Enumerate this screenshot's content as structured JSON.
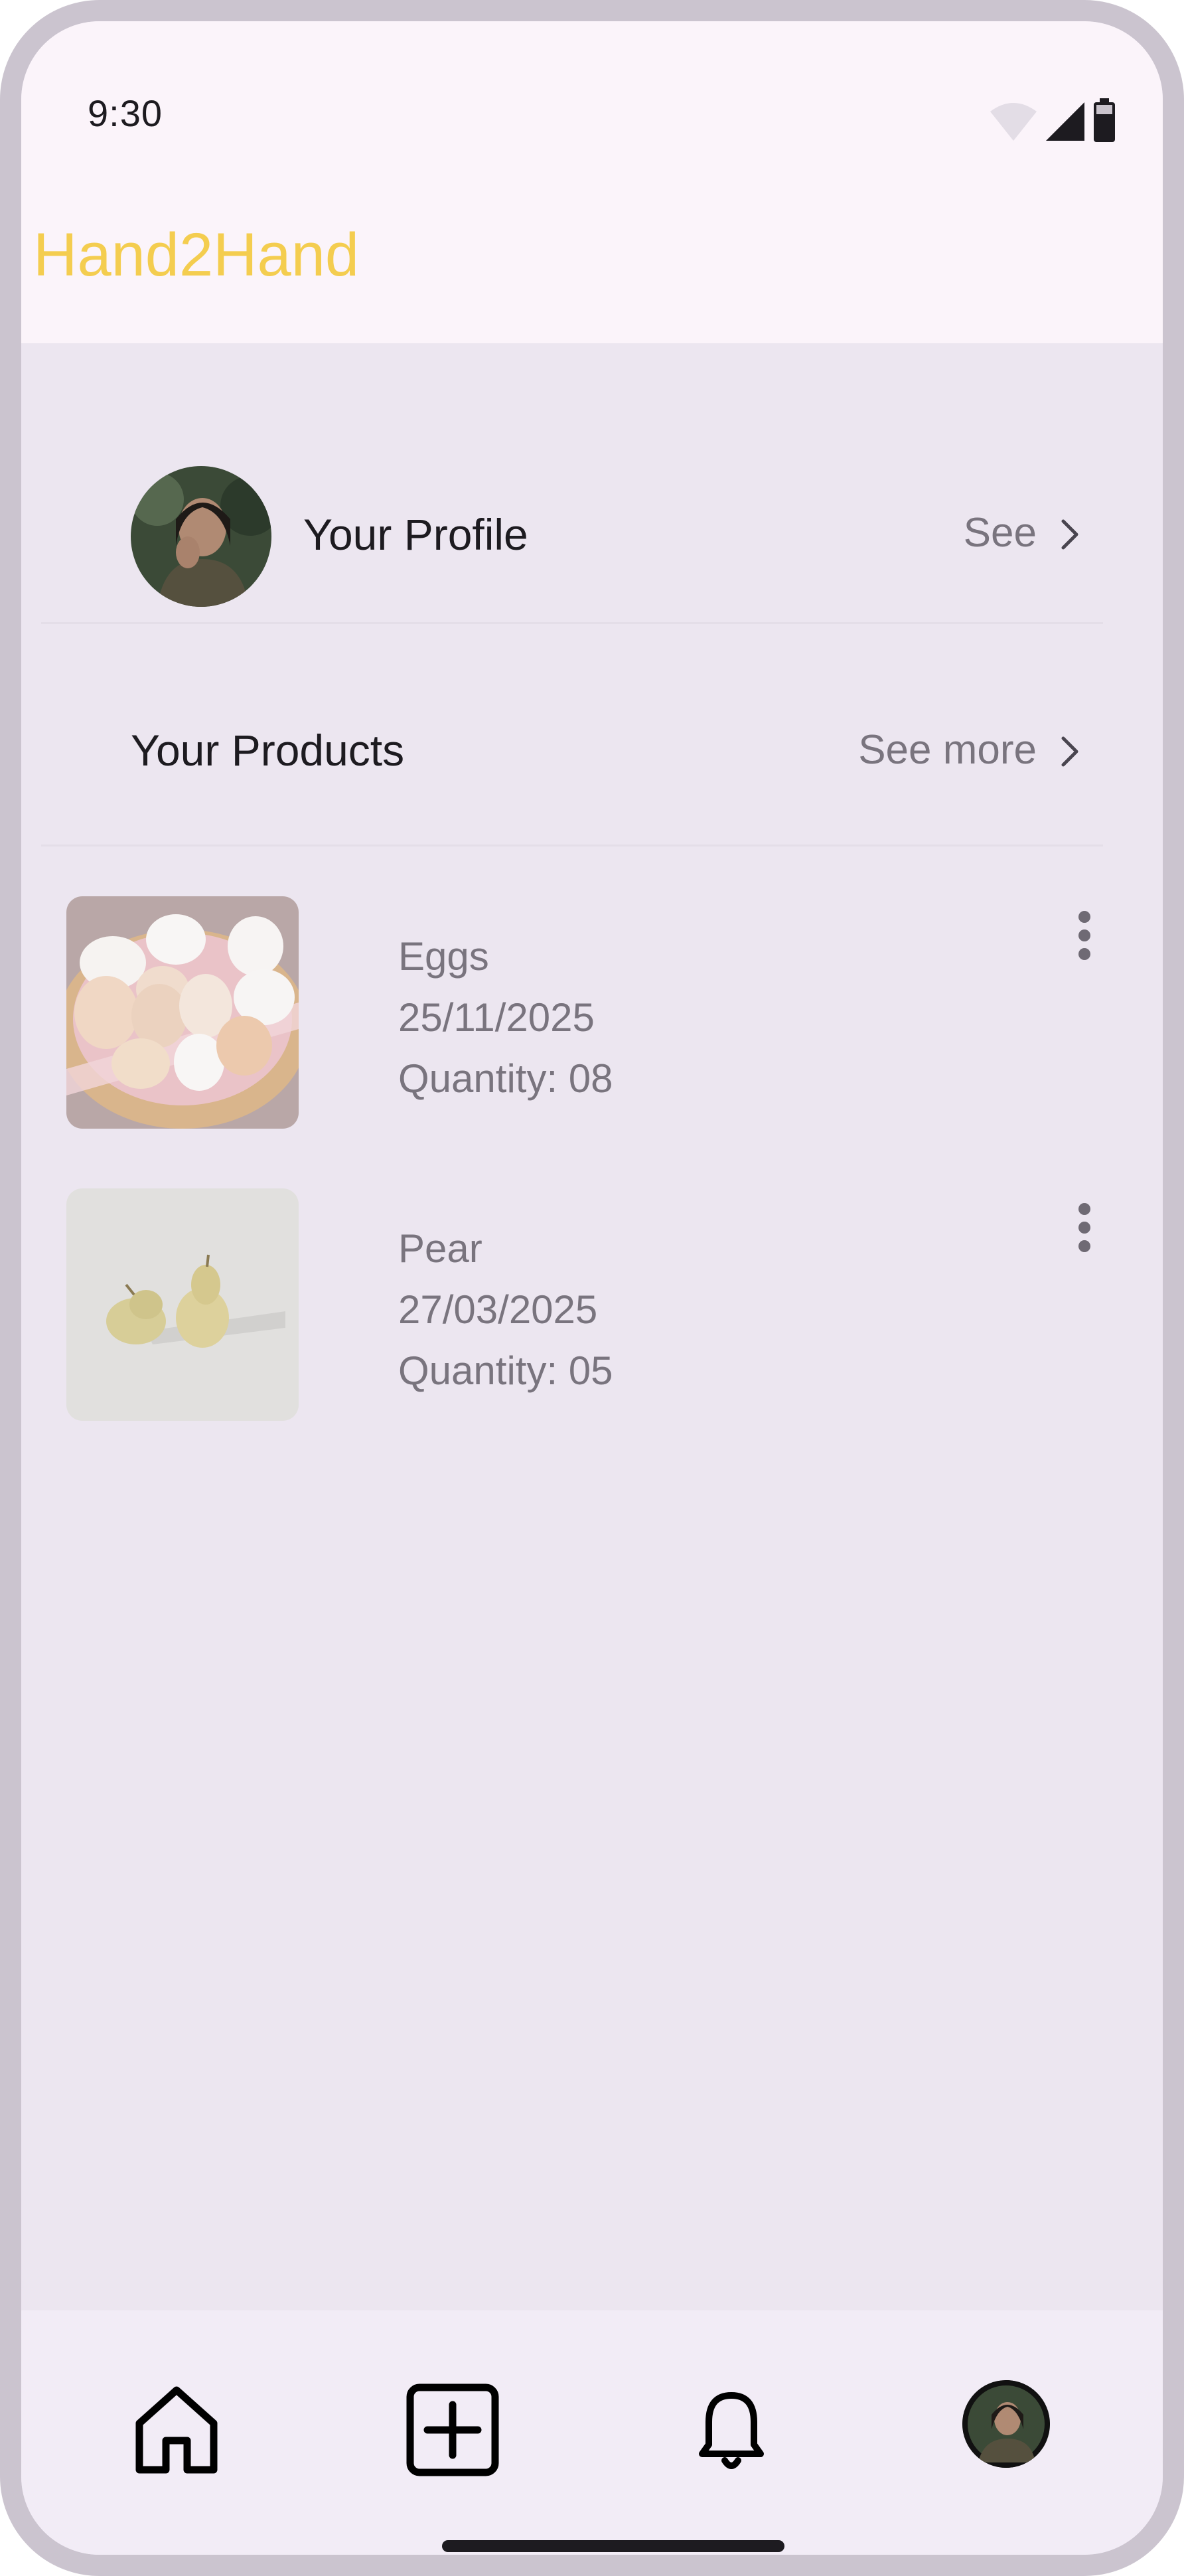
{
  "status_bar": {
    "time": "9:30",
    "icons": [
      "wifi-icon",
      "cellular-signal-icon",
      "battery-icon"
    ]
  },
  "app": {
    "title": "Hand2Hand",
    "title_color": "#F4CD4F"
  },
  "profile_row": {
    "label": "Your Profile",
    "action": "See"
  },
  "products_row": {
    "label": "Your Products",
    "action": "See more"
  },
  "products": [
    {
      "name": "Eggs",
      "date": "25/11/2025",
      "quantity": "Quantity: 08",
      "image": "eggs-basket-image"
    },
    {
      "name": "Pear",
      "date": "27/03/2025",
      "quantity": "Quantity: 05",
      "image": "pears-image"
    }
  ],
  "bottom_nav": {
    "items": [
      "home-icon",
      "add-product-icon",
      "notifications-bell-icon",
      "profile-avatar"
    ]
  }
}
